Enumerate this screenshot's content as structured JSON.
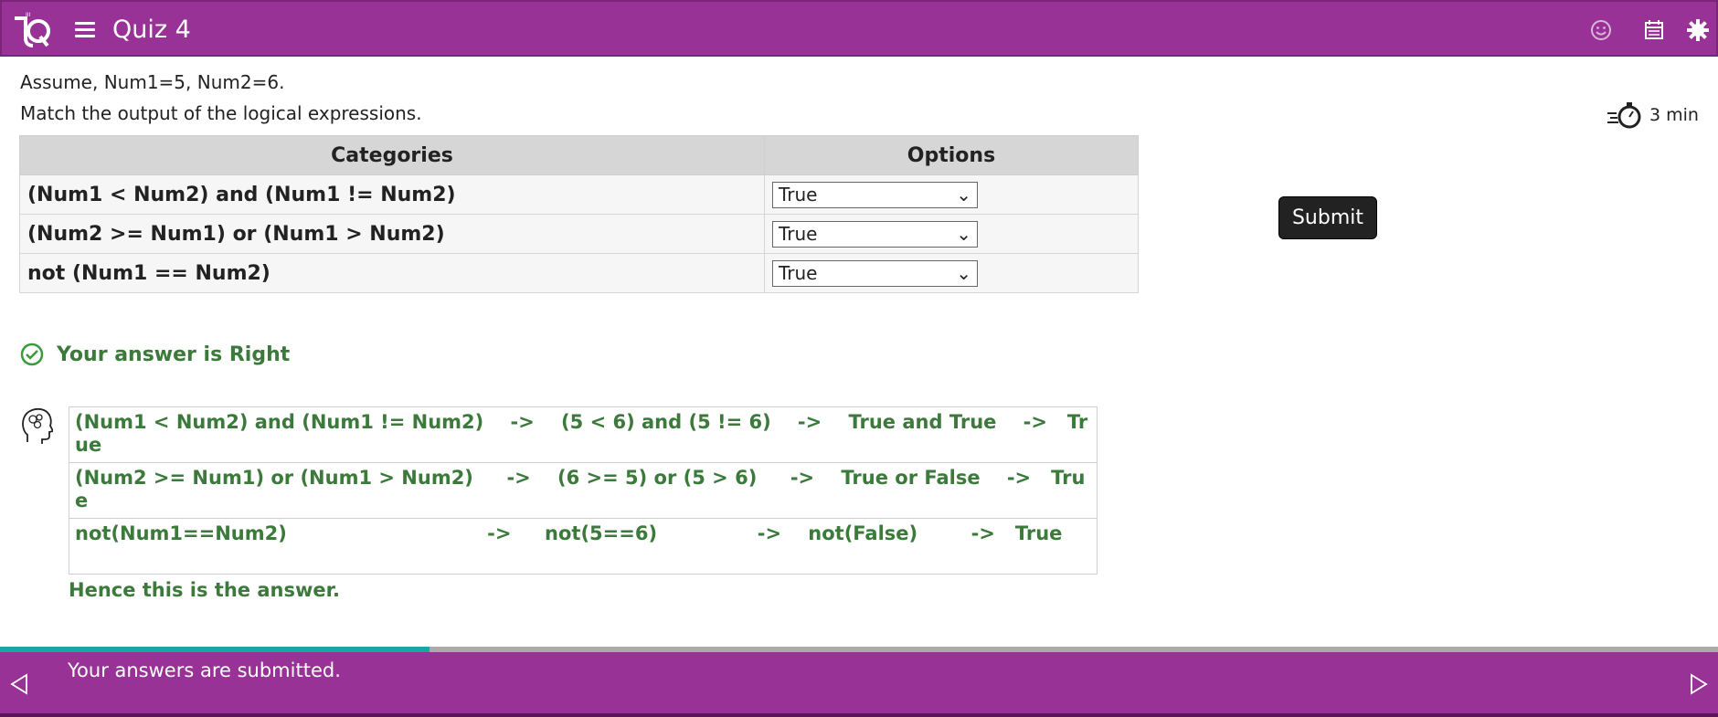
{
  "header": {
    "title": "Quiz 4",
    "icons": [
      "logo-icon",
      "menu-icon",
      "smiley-icon",
      "calendar-icon",
      "settings-icon"
    ]
  },
  "question": {
    "line1": "Assume, Num1=5, Num2=6.",
    "line2": "Match the output of the logical expressions."
  },
  "timer": {
    "label": "3 min"
  },
  "match_table": {
    "headers": [
      "Categories",
      "Options"
    ],
    "rows": [
      {
        "category": "(Num1 < Num2) and (Num1 != Num2)",
        "selected": "True"
      },
      {
        "category": "(Num2 >= Num1) or (Num1 > Num2)",
        "selected": "True"
      },
      {
        "category": "not (Num1 == Num2)",
        "selected": "True"
      }
    ]
  },
  "submit_label": "Submit",
  "result": "Your answer is Right",
  "explanation": {
    "rows": [
      "(Num1 < Num2) and (Num1 != Num2)    ->    (5 < 6) and (5 != 6)    ->    True and True    ->   True",
      "(Num2 >= Num1) or (Num1 > Num2)     ->    (6 >= 5) or (5 > 6)     ->    True or False    ->   True",
      "not(Num1==Num2)                              ->     not(5==6)               ->    not(False)        ->   True"
    ],
    "conclusion": "Hence this is the answer."
  },
  "progress": {
    "fraction": 0.25
  },
  "footer": {
    "status": "Your answers are submitted."
  },
  "colors": {
    "brand": "#983296",
    "success": "#3b7a3b",
    "progress": "#1aa6a6"
  }
}
